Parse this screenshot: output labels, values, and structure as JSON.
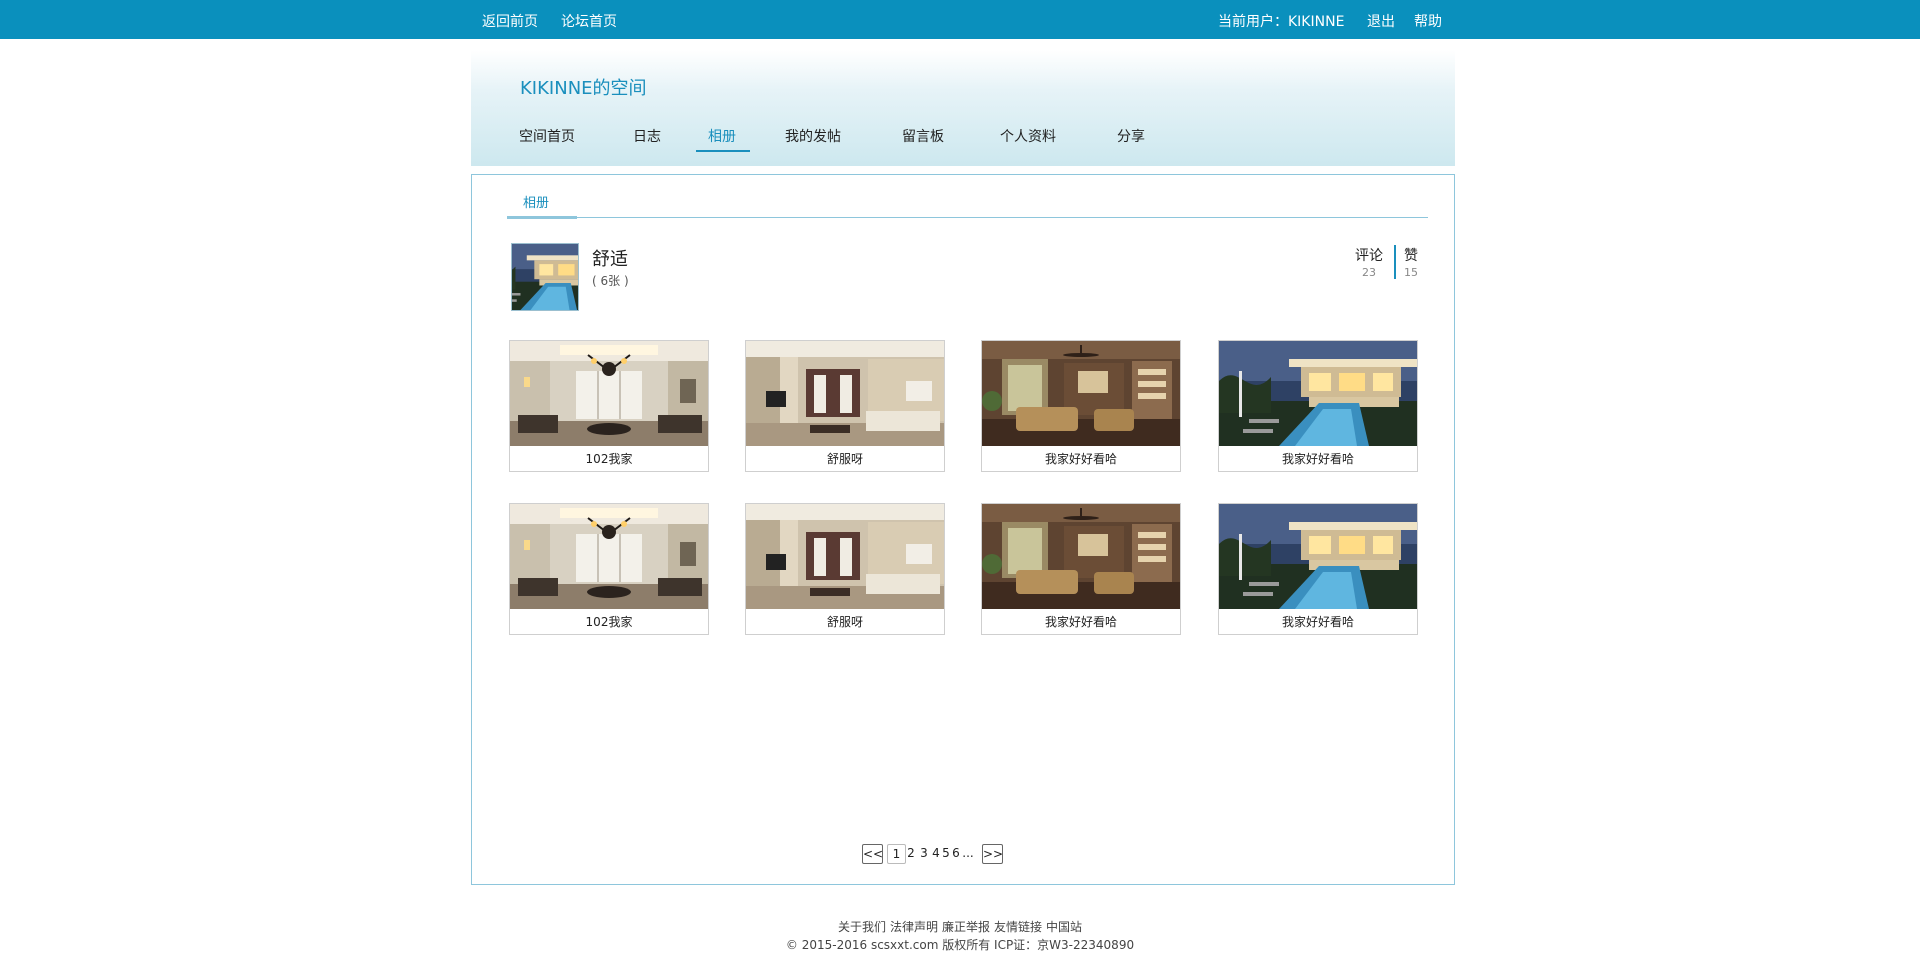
{
  "topbar": {
    "back_home": "返回前页",
    "forum_home": "论坛首页",
    "current_user": "当前用户：KIKINNE",
    "logout": "退出",
    "help": "帮助"
  },
  "space": {
    "title": "KIKINNE的空间",
    "nav": [
      "空间首页",
      "日志",
      "相册",
      "我的发帖",
      "留言板",
      "个人资料",
      "分享"
    ],
    "active_nav": "相册"
  },
  "album_page": {
    "subtab": "相册",
    "album": {
      "name": "舒适",
      "count": "( 6张 )",
      "cover_icon": "villa-pool-thumbnail"
    },
    "stats": {
      "comment_label": "评论",
      "comment_count": "23",
      "like_label": "赞",
      "like_count": "15"
    },
    "photos": [
      {
        "caption": "102我家",
        "icon": "living-room-chandelier-photo"
      },
      {
        "caption": "舒服呀",
        "icon": "modern-living-room-photo"
      },
      {
        "caption": "我家好好看哈",
        "icon": "classic-living-room-photo"
      },
      {
        "caption": "我家好好看哈",
        "icon": "villa-pool-photo"
      },
      {
        "caption": "102我家",
        "icon": "living-room-chandelier-photo"
      },
      {
        "caption": "舒服呀",
        "icon": "modern-living-room-photo"
      },
      {
        "caption": "我家好好看哈",
        "icon": "classic-living-room-photo"
      },
      {
        "caption": "我家好好看哈",
        "icon": "villa-pool-photo"
      }
    ],
    "pager": {
      "prev": "<<",
      "pages": [
        "1",
        "2",
        "3",
        "4",
        "5",
        "6"
      ],
      "ellipsis": "...",
      "next": ">>",
      "current": "1"
    }
  },
  "footer": {
    "links": [
      "关于我们",
      "法律声明",
      "廉正举报",
      "友情链接",
      "中国站"
    ],
    "copyright": "© 2015-2016 scsxxt.com 版权所有 ICP证：京W3-22340890"
  },
  "colors": {
    "brand": "#0a90bd",
    "accent": "#1a8fbd",
    "border": "#8ec6dc"
  }
}
